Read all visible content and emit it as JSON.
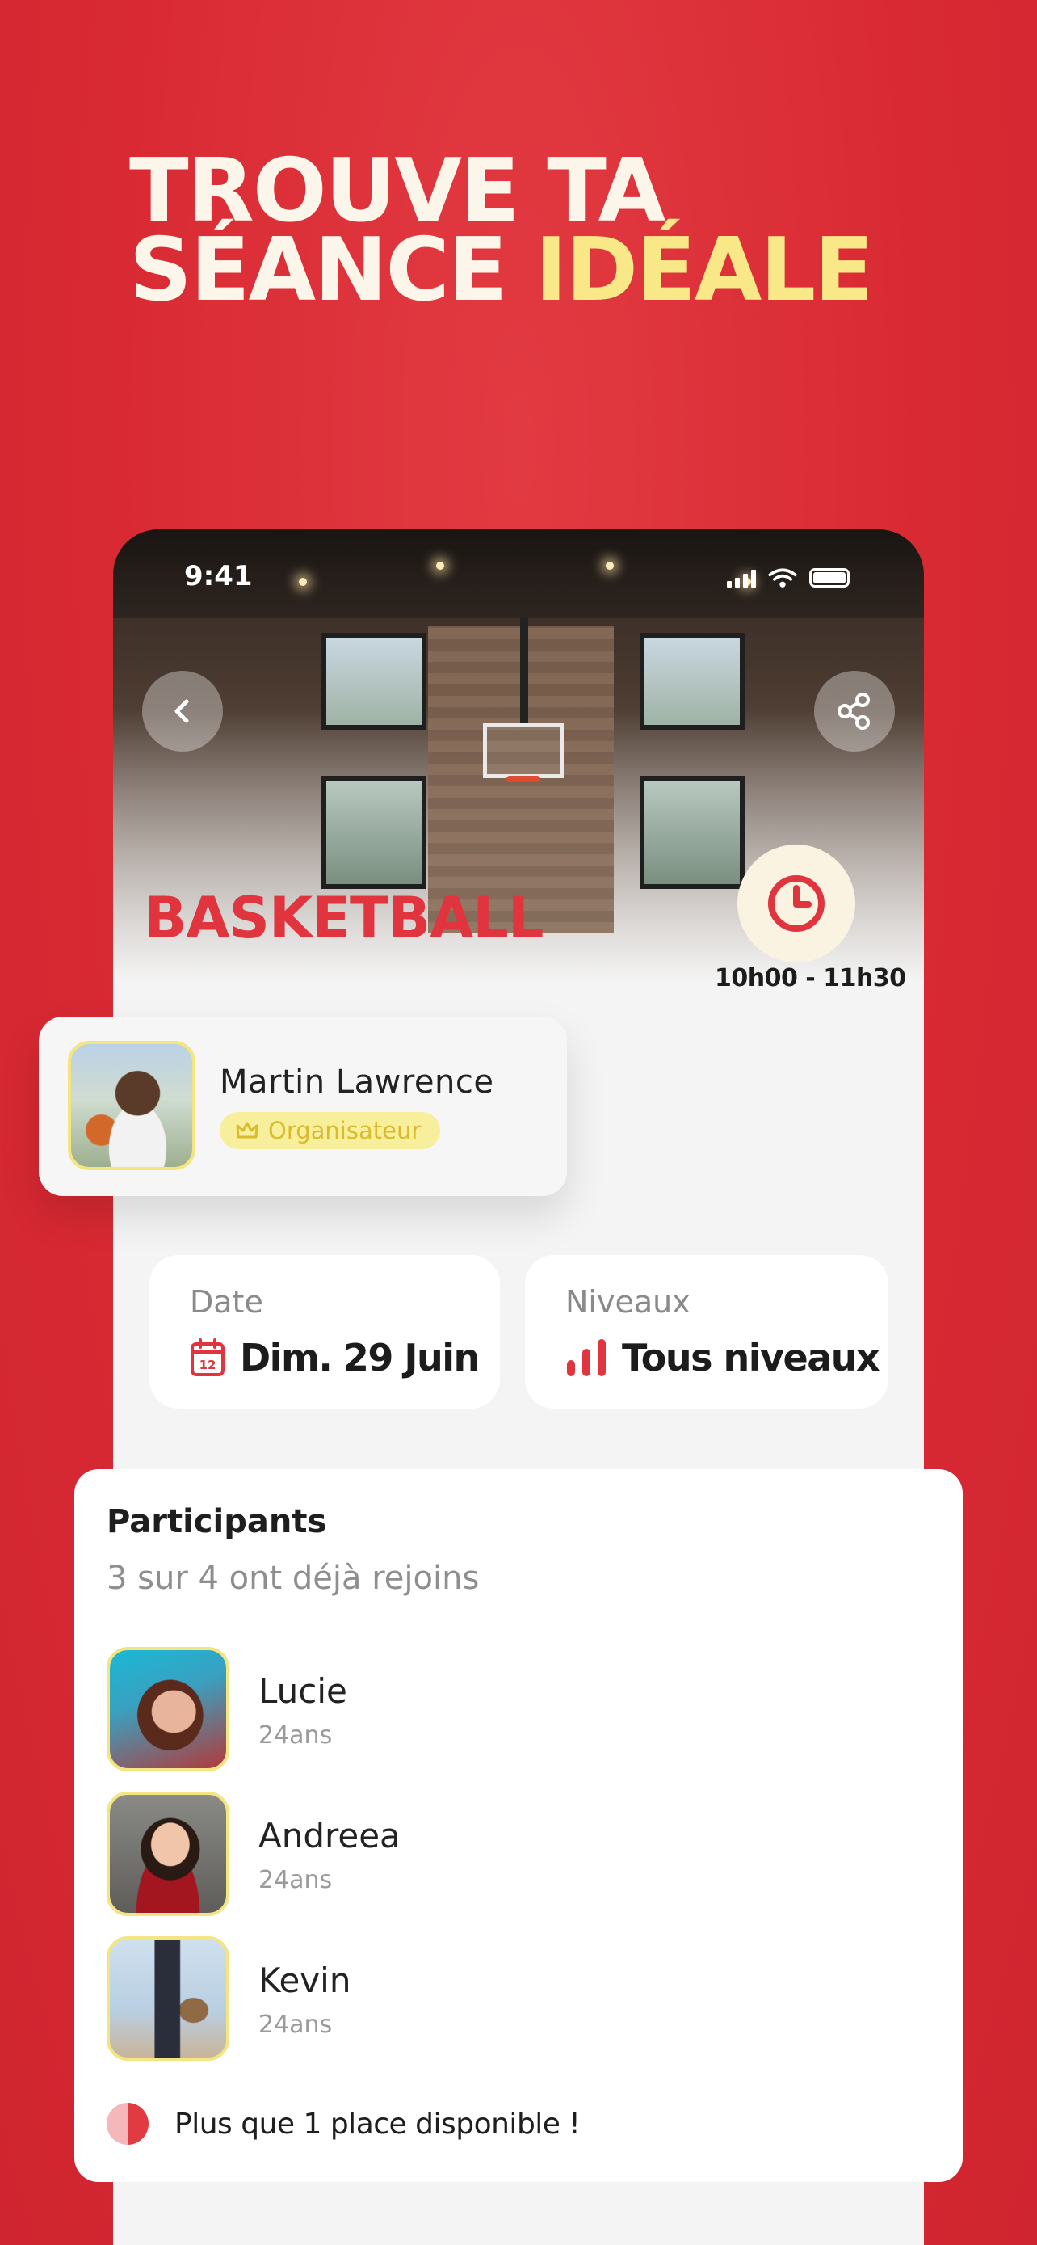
{
  "headline": {
    "line1": "TROUVE TA",
    "line2_a": "SÉANCE ",
    "line2_b": "IDÉALE"
  },
  "status_bar": {
    "time": "9:41"
  },
  "hero": {
    "sport": "BASKETBALL",
    "time_range": "10h00 - 11h30"
  },
  "organizer": {
    "name": "Martin Lawrence",
    "role": "Organisateur"
  },
  "info": {
    "date_label": "Date",
    "date_value": "Dim. 29 Juin",
    "calendar_day": "12",
    "level_label": "Niveaux",
    "level_value": "Tous niveaux"
  },
  "participants": {
    "title": "Participants",
    "subtitle": "3 sur 4 ont déjà rejoins",
    "list": [
      {
        "name": "Lucie",
        "age": "24ans"
      },
      {
        "name": "Andreea",
        "age": "24ans"
      },
      {
        "name": "Kevin",
        "age": "24ans"
      }
    ],
    "availability": "Plus que 1 place disponible !"
  },
  "colors": {
    "brand_red": "#e0353f",
    "accent_yellow": "#f8e888",
    "badge_yellow": "#f7ef9c"
  },
  "icons": [
    "back-icon",
    "share-icon",
    "clock-icon",
    "crown-icon",
    "calendar-icon",
    "level-bars-icon",
    "availability-icon"
  ]
}
